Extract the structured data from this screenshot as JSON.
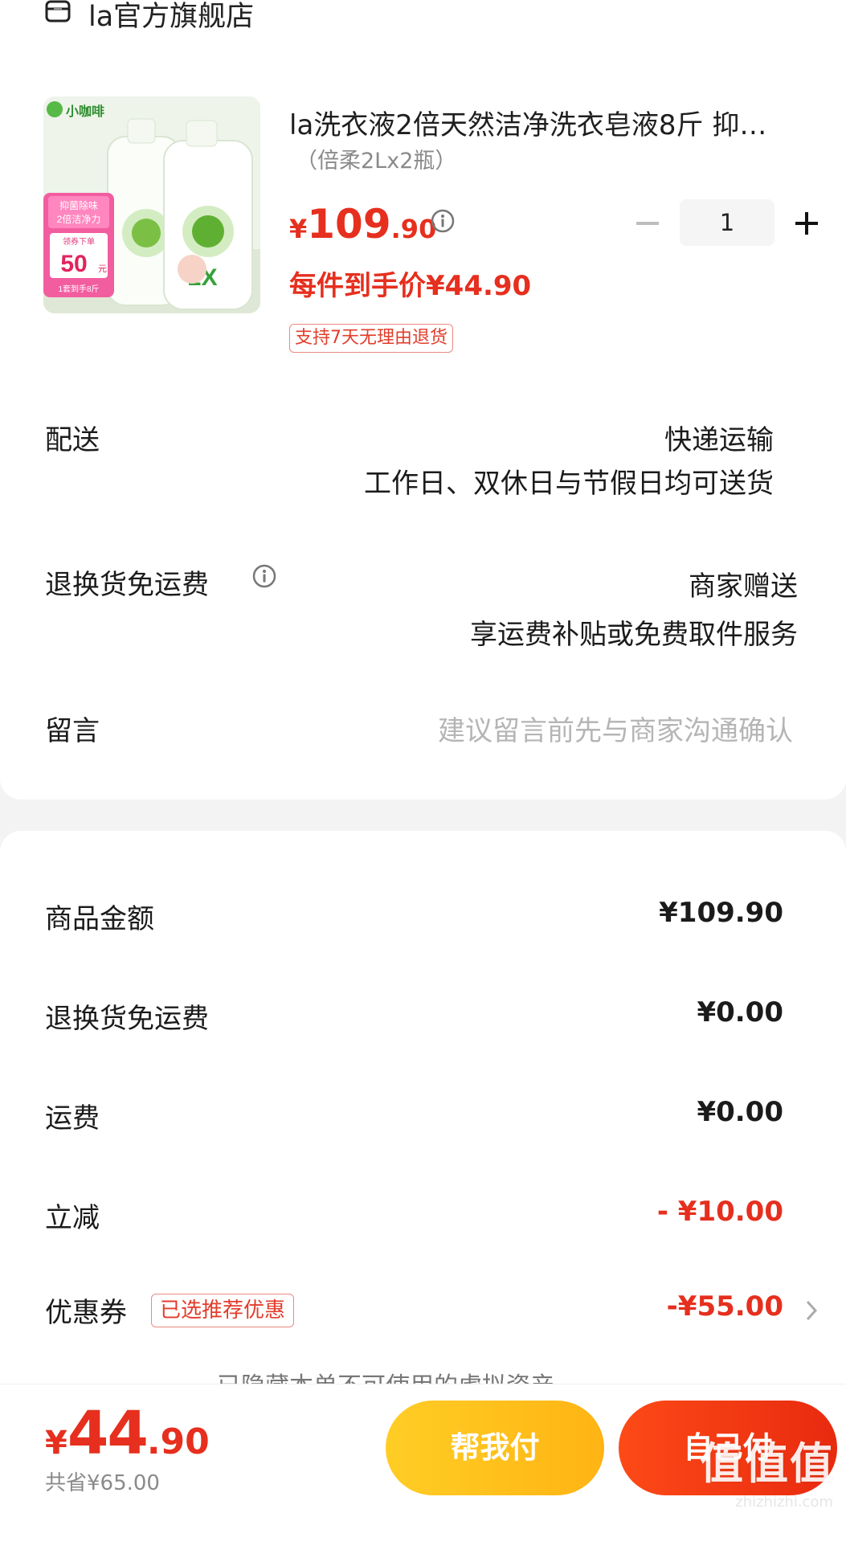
{
  "store": {
    "name": "la官方旗舰店"
  },
  "product": {
    "title": "la洗衣液2倍天然洁净洗衣皂液8斤 抑…",
    "spec": "（倍柔2Lx2瓶）",
    "price_symbol": "¥",
    "price_int": "109",
    "price_dec": ".90",
    "quantity": "1",
    "unit_price_label": "每件到手价¥44.90",
    "return_tag": "支持7天无理由退货",
    "image_texts": {
      "brand": "小咖啡",
      "promo1": "抑菌除味",
      "promo2": "2倍洁净力",
      "promo3": "领券下单",
      "promo_amount": "50",
      "promo_unit": "元",
      "promo_bottom": "1套到手8斤",
      "bottle_label": "2X"
    }
  },
  "delivery": {
    "label": "配送",
    "method": "快递运输",
    "note": "工作日、双休日与节假日均可送货"
  },
  "return_free": {
    "label": "退换货免运费",
    "value": "商家赠送",
    "note": "享运费补贴或免费取件服务"
  },
  "message": {
    "label": "留言",
    "placeholder": "建议留言前先与商家沟通确认"
  },
  "summary": {
    "goods_label": "商品金额",
    "goods_value": "¥109.90",
    "return_label": "退换货免运费",
    "return_value": "¥0.00",
    "shipping_label": "运费",
    "shipping_value": "¥0.00",
    "discount_label": "立减",
    "discount_value": "- ¥10.00",
    "coupon_label": "优惠券",
    "coupon_tag": "已选推荐优惠",
    "coupon_value": "-¥55.00",
    "hidden_note": "已隐藏本单不可使用的虚拟资产 ⌄"
  },
  "bottom": {
    "total_symbol": "¥",
    "total_int": "44",
    "total_dec": ".90",
    "saved": "共省¥65.00",
    "friend_pay": "帮我付",
    "self_pay": "自己付"
  },
  "watermark": {
    "main": "值值值",
    "sub": "zhizhizhi.com"
  },
  "colors": {
    "accent_red": "#e62f1e",
    "friend_btn": "#ffc21f",
    "self_btn": "#f03a13"
  }
}
